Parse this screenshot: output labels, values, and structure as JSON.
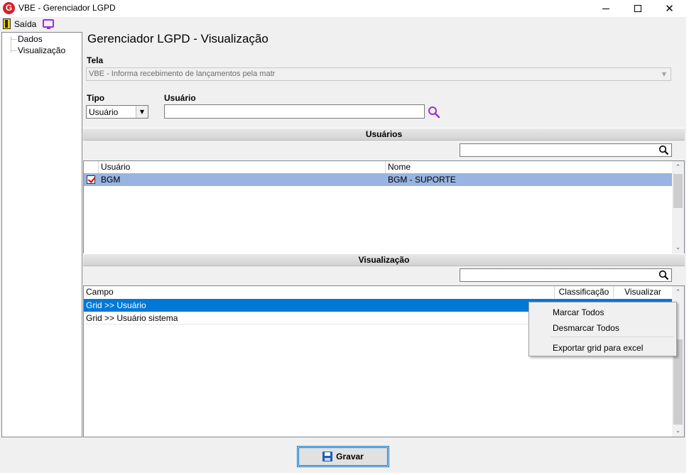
{
  "window": {
    "title": "VBE - Gerenciador LGPD",
    "logo_letter": "G"
  },
  "toolbar": {
    "exit_label": "Saída"
  },
  "tree": {
    "items": [
      "Dados",
      "Visualização"
    ]
  },
  "main": {
    "title": "Gerenciador LGPD - Visualização",
    "tela_label": "Tela",
    "tela_value": "VBE - Informa recebimento de lançamentos pela matr",
    "tipo_label": "Tipo",
    "tipo_value": "Usuário",
    "usuario_label": "Usuário",
    "usuario_value": ""
  },
  "usuarios_section": {
    "title": "Usuários",
    "filter_value": "",
    "columns": [
      "Usuário",
      "Nome"
    ],
    "rows": [
      {
        "checked": true,
        "usuario": "BGM",
        "nome": "BGM - SUPORTE"
      }
    ]
  },
  "visualizacao_section": {
    "title": "Visualização",
    "filter_value": "",
    "columns": [
      "Campo",
      "Classificação",
      "Visualizar"
    ],
    "rows": [
      {
        "campo": "Grid >> Usuário",
        "selected": true
      },
      {
        "campo": "Grid >> Usuário sistema",
        "selected": false
      }
    ]
  },
  "context_menu": {
    "items": [
      "Marcar Todos",
      "Desmarcar Todos",
      "Exportar grid para excel"
    ]
  },
  "footer": {
    "save_label": "Gravar"
  },
  "colors": {
    "selected_row": "#0078d7",
    "highlight_row": "#99b4e0",
    "accent_purple": "#9b2fd4",
    "logo_red": "#d62027"
  }
}
